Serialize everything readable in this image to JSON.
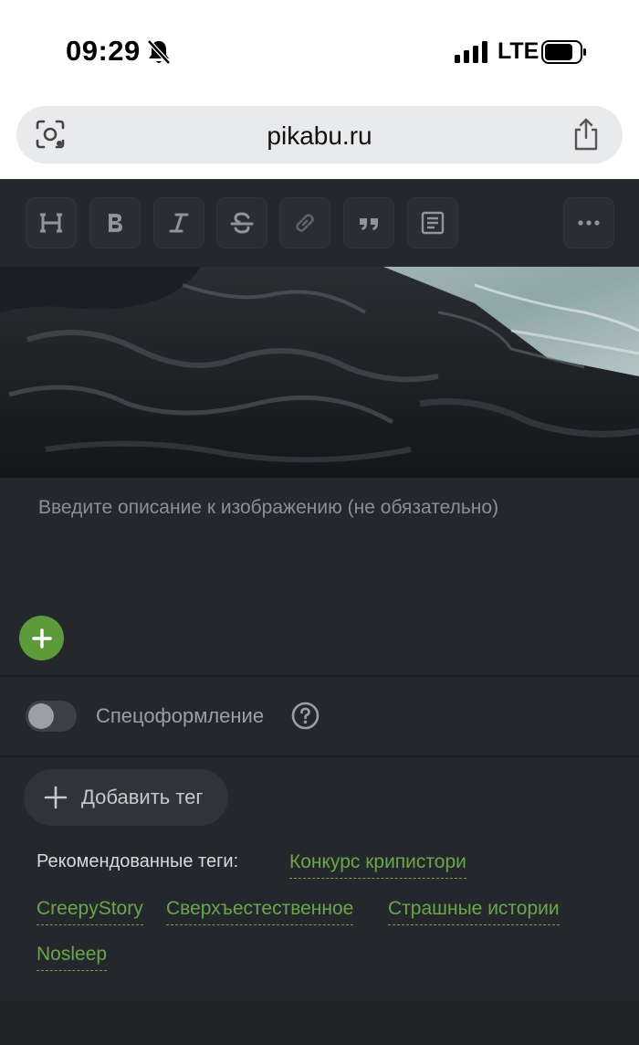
{
  "status_bar": {
    "time": "09:29",
    "network": "LTE"
  },
  "browser": {
    "url": "pikabu.ru"
  },
  "toolbar": {
    "icons": [
      "heading-icon",
      "bold-icon",
      "italic-icon",
      "strikethrough-icon",
      "link-icon",
      "quote-icon",
      "paragraph-icon",
      "more-icon"
    ]
  },
  "editor": {
    "caption_placeholder": "Введите описание к изображению (не обязательно)"
  },
  "options": {
    "special_format_label": "Спецоформление",
    "special_format_enabled": false
  },
  "tags": {
    "add_tag_label": "Добавить тег",
    "recommended_label": "Рекомендованные теги:",
    "recommended": [
      "Конкурс крипистори",
      "CreepyStory",
      "Сверхъестественное",
      "Страшные истории",
      "Nosleep"
    ]
  },
  "colors": {
    "accent": "#5d9a3a",
    "tag": "#6aa64a",
    "background": "#24282c"
  }
}
